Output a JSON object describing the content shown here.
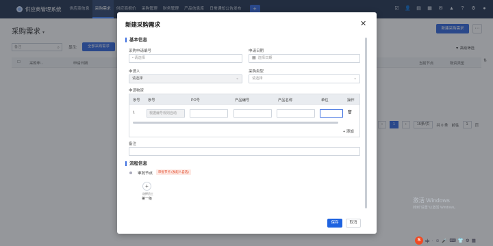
{
  "app": {
    "title": "供应商管理系统",
    "nav": [
      "供应商信息",
      "采购需求",
      "供应商报价",
      "采购管理",
      "财务管理",
      "产品信息库",
      "日常通知公告发布"
    ],
    "nav_active_index": 1,
    "plus_label": "+",
    "accent": "#3d6fe0"
  },
  "page": {
    "title": "采购需求",
    "new_button": "新建采购需求",
    "more_button": "···",
    "filter_placeholder": "备注",
    "show_label": "显示:",
    "all_button": "全部采购需求",
    "advanced_filter": "高级筛选",
    "columns": [
      "采购申...",
      "申请日期",
      "当前节点",
      "物资类型"
    ],
    "pager": {
      "prev": "‹",
      "current": "1",
      "next": "›",
      "page_size": "15条/页",
      "total": "共 0 条",
      "goto_label": "前往",
      "goto_value": "1",
      "goto_unit": "页"
    }
  },
  "modal": {
    "title": "新建采购需求",
    "close": "✕",
    "section_basic": "基本信息",
    "req_no_label": "采购申请编号",
    "req_no_placeholder": "• 请选择",
    "date_label": "申请日期",
    "date_placeholder": "选择日期",
    "applicant_label": "申请人",
    "applicant_value": "请选择",
    "type_label": "采购类型",
    "type_value": "请选择",
    "goods_label": "申请物资",
    "goods_columns": [
      "序号",
      "序号",
      "PO号",
      "产品编号",
      "产品名称",
      "单位",
      "操作"
    ],
    "goods_row_index": "1",
    "goods_auto_placeholder": "根据编号规则自动",
    "add_label": "+ 添加",
    "remark_label": "备注",
    "section_flow": "流程信息",
    "approval_label": "审批节点",
    "approval_tag": "审批节点 (发起人自选)",
    "flow_add": "+",
    "flow_sub": "选择员工",
    "flow_first": "第一级",
    "save": "保存",
    "cancel": "取消"
  },
  "os": {
    "watermark_line1": "激活 Windows",
    "watermark_line2": "转到\"设置\"以激活 Windows。",
    "tray": [
      "S",
      "中",
      "·",
      "☺",
      "🎤",
      "⌨",
      "👕",
      "⚙",
      "▦"
    ]
  }
}
